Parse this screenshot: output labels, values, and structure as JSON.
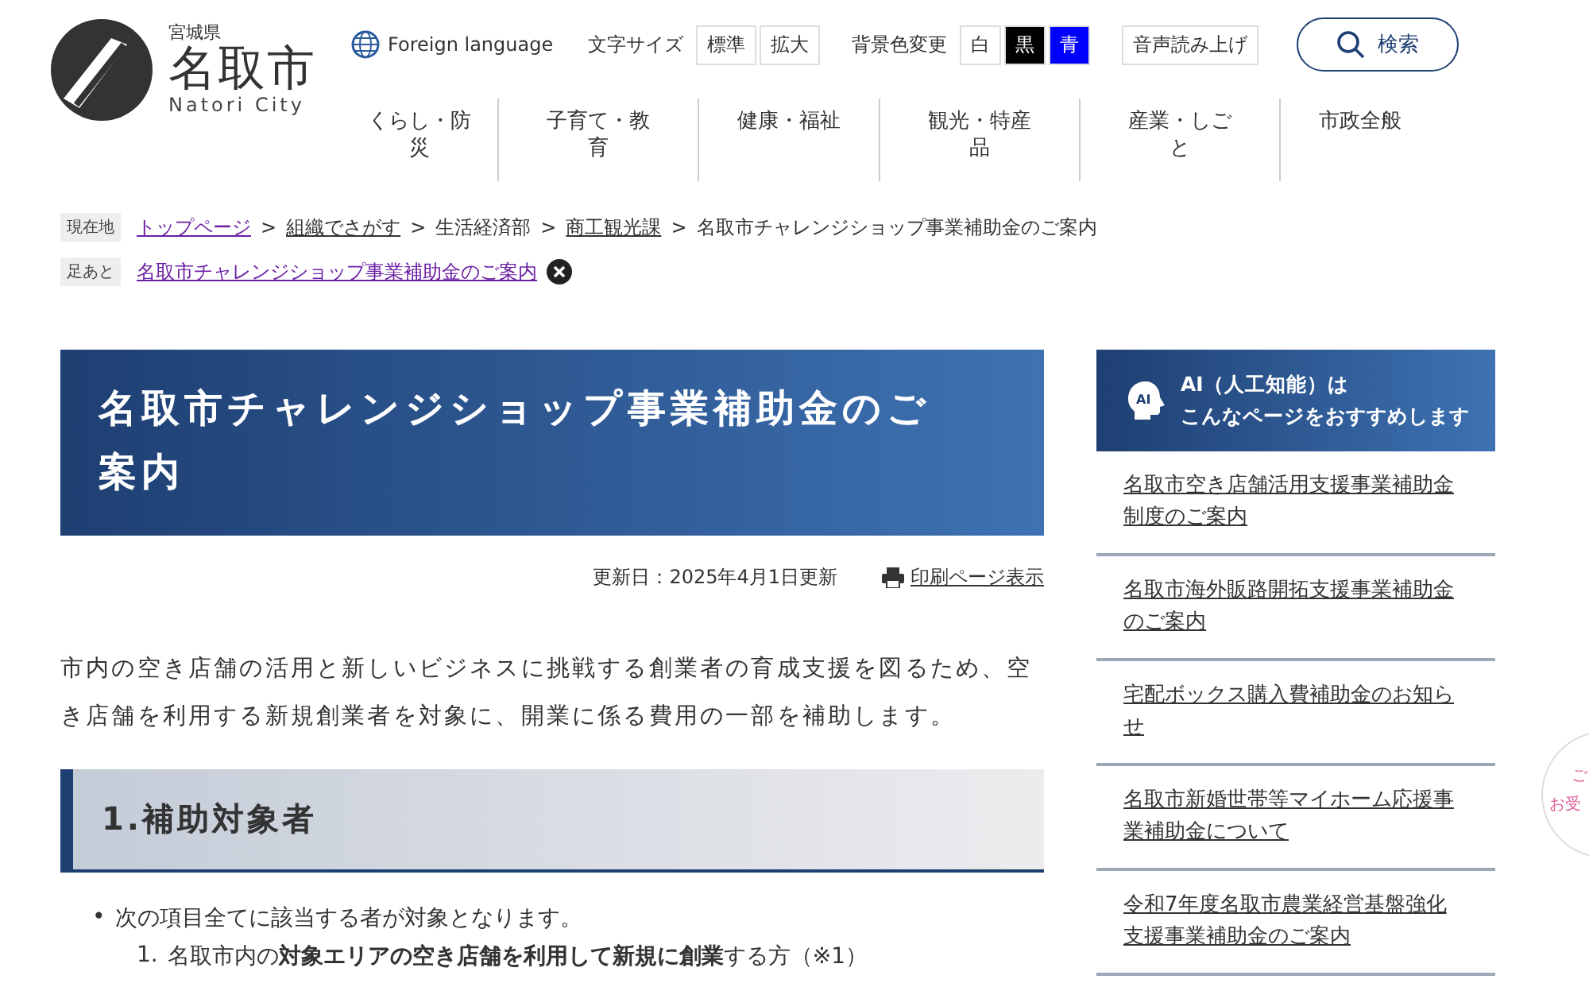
{
  "logo": {
    "prefecture": "宮城県",
    "city": "名取市",
    "romaji": "Natori City"
  },
  "utility": {
    "language": "Foreign language",
    "font_size_label": "文字サイズ",
    "font_sizes": [
      "標準",
      "拡大"
    ],
    "bg_label": "背景色変更",
    "bg_options": [
      {
        "label": "白",
        "color": "#ffffff"
      },
      {
        "label": "黒",
        "color": "#000000"
      },
      {
        "label": "青",
        "color": "#0000ff"
      }
    ],
    "read_aloud": "音声読み上げ",
    "search": "検索"
  },
  "nav": [
    "くらし・防災",
    "子育て・教育",
    "健康・福祉",
    "観光・特産品",
    "産業・しごと",
    "市政全般"
  ],
  "breadcrumb": {
    "label": "現在地",
    "items": [
      {
        "text": "トップページ",
        "link": true,
        "visited": true
      },
      {
        "text": "組織でさがす",
        "link": true,
        "visited": false
      },
      {
        "text": "生活経済部",
        "link": false,
        "visited": false
      },
      {
        "text": "商工観光課",
        "link": true,
        "visited": false
      },
      {
        "text": "名取市チャレンジショップ事業補助金のご案内",
        "link": false,
        "visited": false
      }
    ],
    "separator": ">"
  },
  "footprint": {
    "label": "足あと",
    "link": "名取市チャレンジショップ事業補助金のご案内"
  },
  "page_title": "名取市チャレンジショップ事業補助金のご案内",
  "updated": "更新日：2025年4月1日更新",
  "print": "印刷ページ表示",
  "intro": "市内の空き店舗の活用と新しいビジネスに挑戦する創業者の育成支援を図るため、空き店舗を利用する新規創業者を対象に、開業に係る費用の一部を補助します。",
  "section_heading": "1.補助対象者",
  "bullet": {
    "mark": "•",
    "text": "次の項目全てに該当する者が対象となります。",
    "items": [
      {
        "number": "1.",
        "text": "名取市内の**対象エリアの空き店舗を利用して新規に創業**する方（※1）"
      }
    ]
  },
  "sidebar": {
    "icon_label": "AI",
    "title_lines": [
      "AI（人工知能）は",
      "こんなページをおすすめします"
    ],
    "links": [
      "名取市空き店舗活用支援事業補助金制度のご案内",
      "名取市海外販路開拓支援事業補助金のご案内",
      "宅配ボックス購入費補助金のお知らせ",
      "名取市新婚世帯等マイホーム応援事業補助金について",
      "令和7年度名取市農業経営基盤強化支援事業補助金のご案内"
    ]
  },
  "floating_badge": [
    "ご",
    "お受"
  ]
}
